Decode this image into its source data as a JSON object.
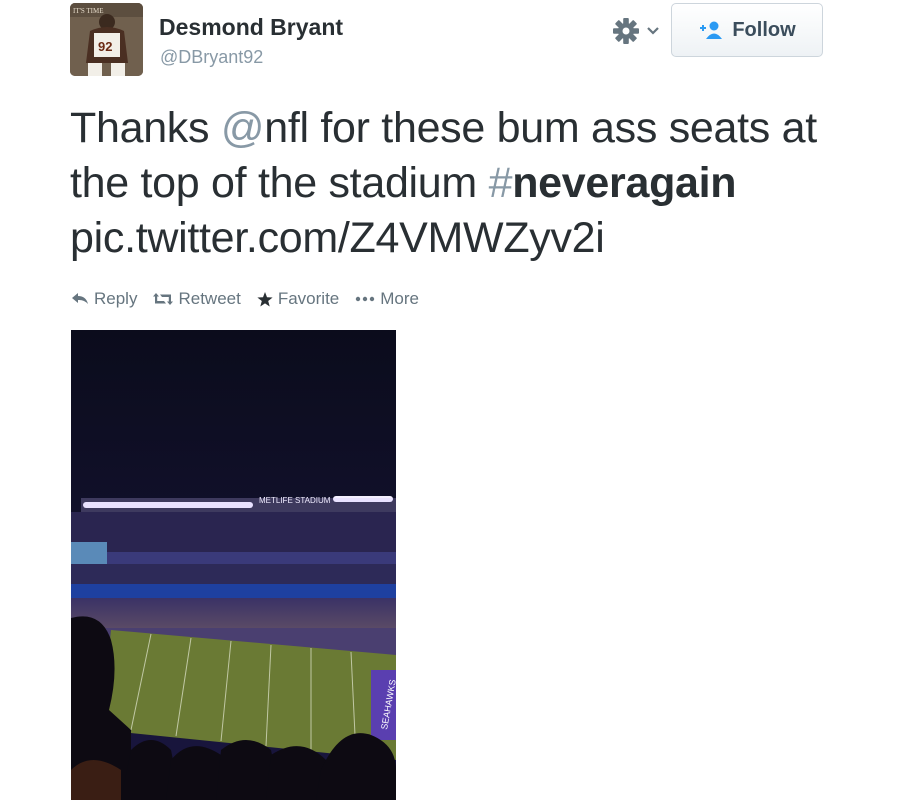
{
  "user": {
    "name": "Desmond Bryant",
    "handle": "@DBryant92",
    "avatar_jersey": "92",
    "avatar_banner": "IT'S TIME"
  },
  "follow_button": {
    "label": "Follow",
    "icon": "add-user-icon"
  },
  "gear_menu": {
    "icon": "gear-icon",
    "caret": "chevron-down-icon"
  },
  "tweet": {
    "text_1": "Thanks ",
    "mention_prefix": "@",
    "mention": "nfl",
    "text_2": " for these bum ass seats at the top of the stadium ",
    "hashtag_prefix": "#",
    "hashtag": "neveragain",
    "pic_link": "pic.twitter.com/Z4VMWZyv2i"
  },
  "actions": [
    {
      "label": "Reply",
      "icon": "reply-icon"
    },
    {
      "label": "Retweet",
      "icon": "retweet-icon"
    },
    {
      "label": "Favorite",
      "icon": "star-icon"
    },
    {
      "label": "More",
      "icon": "more-dots-icon"
    }
  ],
  "media": {
    "stadium_sign": "METLIFE STADIUM",
    "endzone_text": "SEAHAWKS"
  },
  "colors": {
    "text": "#292f33",
    "muted": "#8899a6",
    "follow_icon": "#2b9af3"
  }
}
